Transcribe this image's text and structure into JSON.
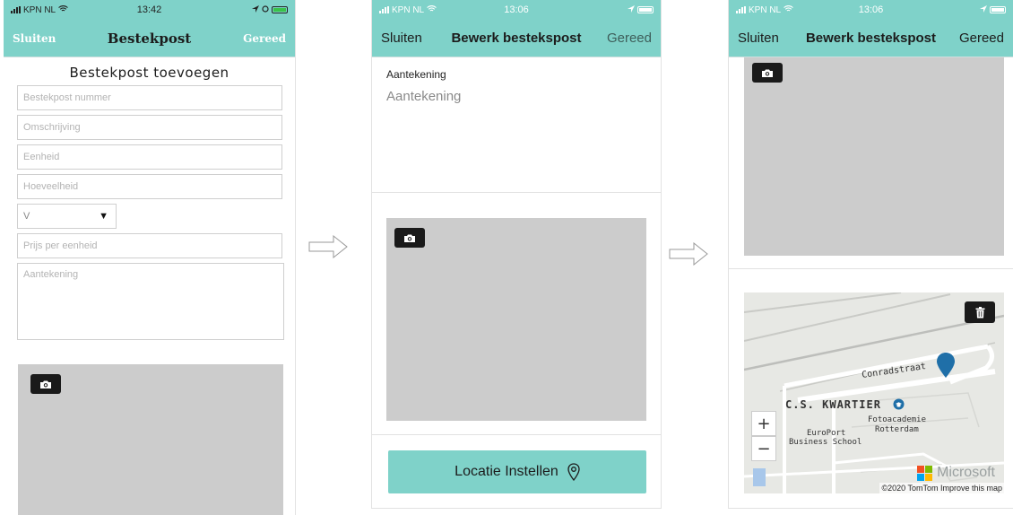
{
  "screen1": {
    "status": {
      "carrier": "KPN NL",
      "time": "13:42"
    },
    "nav": {
      "left": "Sluiten",
      "title": "Bestekpost",
      "right": "Gereed"
    },
    "form_title": "Bestekpost toevoegen",
    "fields": {
      "nummer": "Bestekpost nummer",
      "omschrijving": "Omschrijving",
      "eenheid": "Eenheid",
      "hoeveelheid": "Hoeveelheid",
      "select_value": "V",
      "prijs": "Prijs per eenheid",
      "aantekening": "Aantekening"
    },
    "caret": "▼"
  },
  "screen2": {
    "status": {
      "carrier": "KPN NL",
      "time": "13:06"
    },
    "nav": {
      "left": "Sluiten",
      "title": "Bewerk bestekspost",
      "right": "Gereed"
    },
    "note_label": "Aantekening",
    "note_placeholder": "Aantekening",
    "location_button": "Locatie Instellen"
  },
  "screen3": {
    "status": {
      "carrier": "KPN NL",
      "time": "13:06"
    },
    "nav": {
      "left": "Sluiten",
      "title": "Bewerk bestekspost",
      "right": "Gereed"
    },
    "map": {
      "street": "Conradstraat",
      "district": "C.S. KWARTIER",
      "poi1_line1": "Fotoacademie",
      "poi1_line2": "Rotterdam",
      "poi2_line1": "EuroPort",
      "poi2_line2": "Business School",
      "zoom_in": "+",
      "zoom_out": "−",
      "brand": "Microsoft",
      "copyright": "©2020 TomTom Improve this map"
    }
  },
  "colors": {
    "accent": "#7fd2c9",
    "photo_placeholder": "#cccccc",
    "pin": "#1f6fa8"
  },
  "icons": [
    "camera-icon",
    "location-pin-icon",
    "trash-icon",
    "arrow-right-icon",
    "wifi-icon",
    "battery-icon"
  ]
}
